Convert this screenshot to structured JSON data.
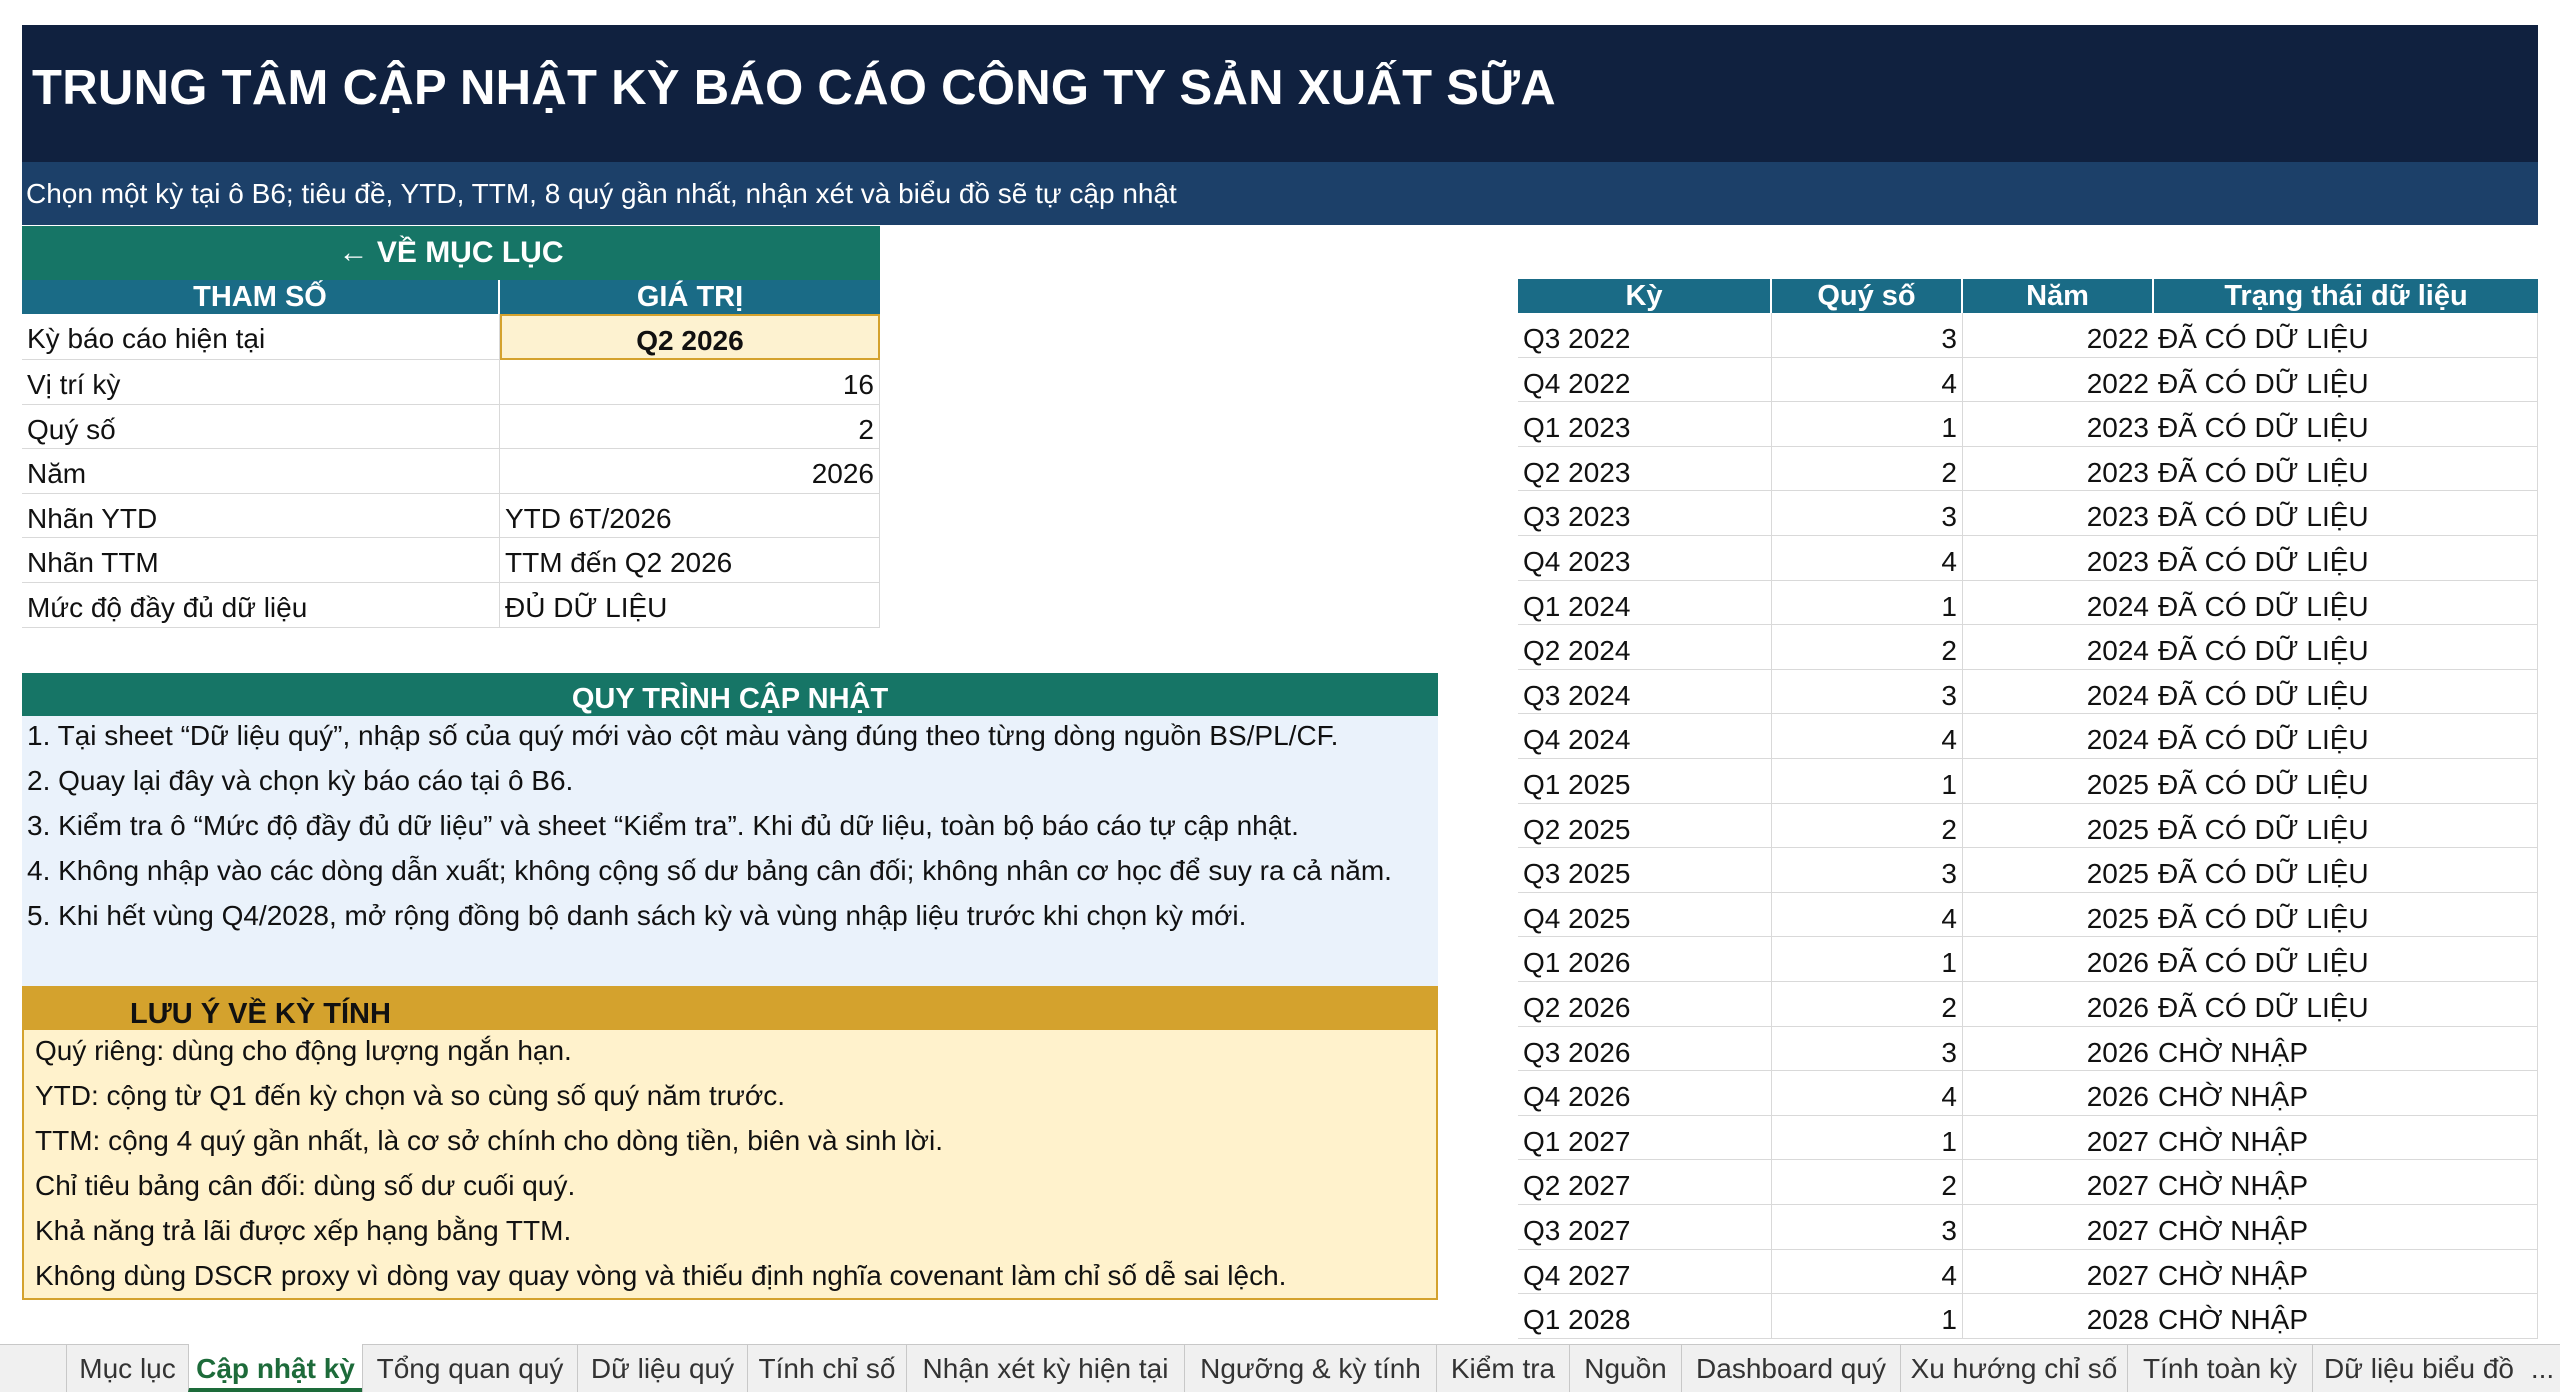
{
  "header": {
    "title": "TRUNG TÂM CẬP NHẬT KỲ BÁO CÁO CÔNG TY SẢN XUẤT SỮA",
    "subtitle": "Chọn một kỳ tại ô B6; tiêu đề, YTD, TTM, 8 quý gần nhất, nhận xét và biểu đồ sẽ tự cập nhật"
  },
  "params": {
    "back_label": "← VỀ MỤC LỤC",
    "col_param": "THAM SỐ",
    "col_value": "GIÁ TRỊ",
    "rows": [
      {
        "label": "Kỳ báo cáo hiện tại",
        "value": "Q2 2026"
      },
      {
        "label": "Vị trí kỳ",
        "value": "16"
      },
      {
        "label": "Quý số",
        "value": "2"
      },
      {
        "label": "Năm",
        "value": "2026"
      },
      {
        "label": "Nhãn YTD",
        "value": "YTD 6T/2026"
      },
      {
        "label": "Nhãn TTM",
        "value": "TTM đến Q2 2026"
      },
      {
        "label": "Mức độ đầy đủ dữ liệu",
        "value": "ĐỦ DỮ LIỆU"
      }
    ]
  },
  "process": {
    "title": "QUY TRÌNH CẬP NHẬT",
    "steps": [
      "1. Tại sheet “Dữ liệu quý”, nhập số của quý mới vào cột màu vàng đúng theo từng dòng nguồn BS/PL/CF.",
      "2. Quay lại đây và chọn kỳ báo cáo tại ô B6.",
      "3. Kiểm tra ô “Mức độ đầy đủ dữ liệu” và sheet “Kiểm tra”. Khi đủ dữ liệu, toàn bộ báo cáo tự cập nhật.",
      "4. Không nhập vào các dòng dẫn xuất; không cộng số dư bảng cân đối; không nhân cơ học để suy ra cả năm.",
      "5. Khi hết vùng Q4/2028, mở rộng đồng bộ danh sách kỳ và vùng nhập liệu trước khi chọn kỳ mới."
    ]
  },
  "notes": {
    "title": "LƯU Ý VỀ KỲ TÍNH",
    "lines": [
      "Quý riêng: dùng cho động lượng ngắn hạn.",
      "YTD: cộng từ Q1 đến kỳ chọn và so cùng số quý năm trước.",
      "TTM: cộng 4 quý gần nhất, là cơ sở chính cho dòng tiền, biên và sinh lời.",
      "Chỉ tiêu bảng cân đối: dùng số dư cuối quý.",
      "Khả năng trả lãi được xếp hạng bằng TTM.",
      "Không dùng DSCR proxy vì dòng vay quay vòng và thiếu định nghĩa covenant làm chỉ số dễ sai lệch."
    ]
  },
  "periods": {
    "headers": [
      "Kỳ",
      "Quý số",
      "Năm",
      "Trạng thái dữ liệu"
    ],
    "rows": [
      [
        "Q3 2022",
        "3",
        "2022",
        "ĐÃ CÓ DỮ LIỆU"
      ],
      [
        "Q4 2022",
        "4",
        "2022",
        "ĐÃ CÓ DỮ LIỆU"
      ],
      [
        "Q1 2023",
        "1",
        "2023",
        "ĐÃ CÓ DỮ LIỆU"
      ],
      [
        "Q2 2023",
        "2",
        "2023",
        "ĐÃ CÓ DỮ LIỆU"
      ],
      [
        "Q3 2023",
        "3",
        "2023",
        "ĐÃ CÓ DỮ LIỆU"
      ],
      [
        "Q4 2023",
        "4",
        "2023",
        "ĐÃ CÓ DỮ LIỆU"
      ],
      [
        "Q1 2024",
        "1",
        "2024",
        "ĐÃ CÓ DỮ LIỆU"
      ],
      [
        "Q2 2024",
        "2",
        "2024",
        "ĐÃ CÓ DỮ LIỆU"
      ],
      [
        "Q3 2024",
        "3",
        "2024",
        "ĐÃ CÓ DỮ LIỆU"
      ],
      [
        "Q4 2024",
        "4",
        "2024",
        "ĐÃ CÓ DỮ LIỆU"
      ],
      [
        "Q1 2025",
        "1",
        "2025",
        "ĐÃ CÓ DỮ LIỆU"
      ],
      [
        "Q2 2025",
        "2",
        "2025",
        "ĐÃ CÓ DỮ LIỆU"
      ],
      [
        "Q3 2025",
        "3",
        "2025",
        "ĐÃ CÓ DỮ LIỆU"
      ],
      [
        "Q4 2025",
        "4",
        "2025",
        "ĐÃ CÓ DỮ LIỆU"
      ],
      [
        "Q1 2026",
        "1",
        "2026",
        "ĐÃ CÓ DỮ LIỆU"
      ],
      [
        "Q2 2026",
        "2",
        "2026",
        "ĐÃ CÓ DỮ LIỆU"
      ],
      [
        "Q3 2026",
        "3",
        "2026",
        "CHỜ NHẬP"
      ],
      [
        "Q4 2026",
        "4",
        "2026",
        "CHỜ NHẬP"
      ],
      [
        "Q1 2027",
        "1",
        "2027",
        "CHỜ NHẬP"
      ],
      [
        "Q2 2027",
        "2",
        "2027",
        "CHỜ NHẬP"
      ],
      [
        "Q3 2027",
        "3",
        "2027",
        "CHỜ NHẬP"
      ],
      [
        "Q4 2027",
        "4",
        "2027",
        "CHỜ NHẬP"
      ],
      [
        "Q1 2028",
        "1",
        "2028",
        "CHỜ NHẬP"
      ]
    ]
  },
  "tabs": {
    "items": [
      "Mục lục",
      "Cập nhật kỳ",
      "Tổng quan quý",
      "Dữ liệu quý",
      "Tính chỉ số",
      "Nhận xét kỳ hiện tại",
      "Ngưỡng & kỳ tính",
      "Kiểm tra",
      "Nguồn",
      "Dashboard quý",
      "Xu hướng chỉ số",
      "Tính toàn kỳ",
      "Dữ liệu biểu đồ",
      "..."
    ],
    "active": "Cập nhật kỳ"
  },
  "colors": {
    "title_bg": "#10213f",
    "subtitle_bg": "#1c4069",
    "teal_header": "#167566",
    "table_header": "#1a6b86",
    "gold": "#d4a22d",
    "note_fill": "#fff2cc",
    "selected_cell": "#fdf2d0",
    "active_tab": "#1d6b3a"
  }
}
